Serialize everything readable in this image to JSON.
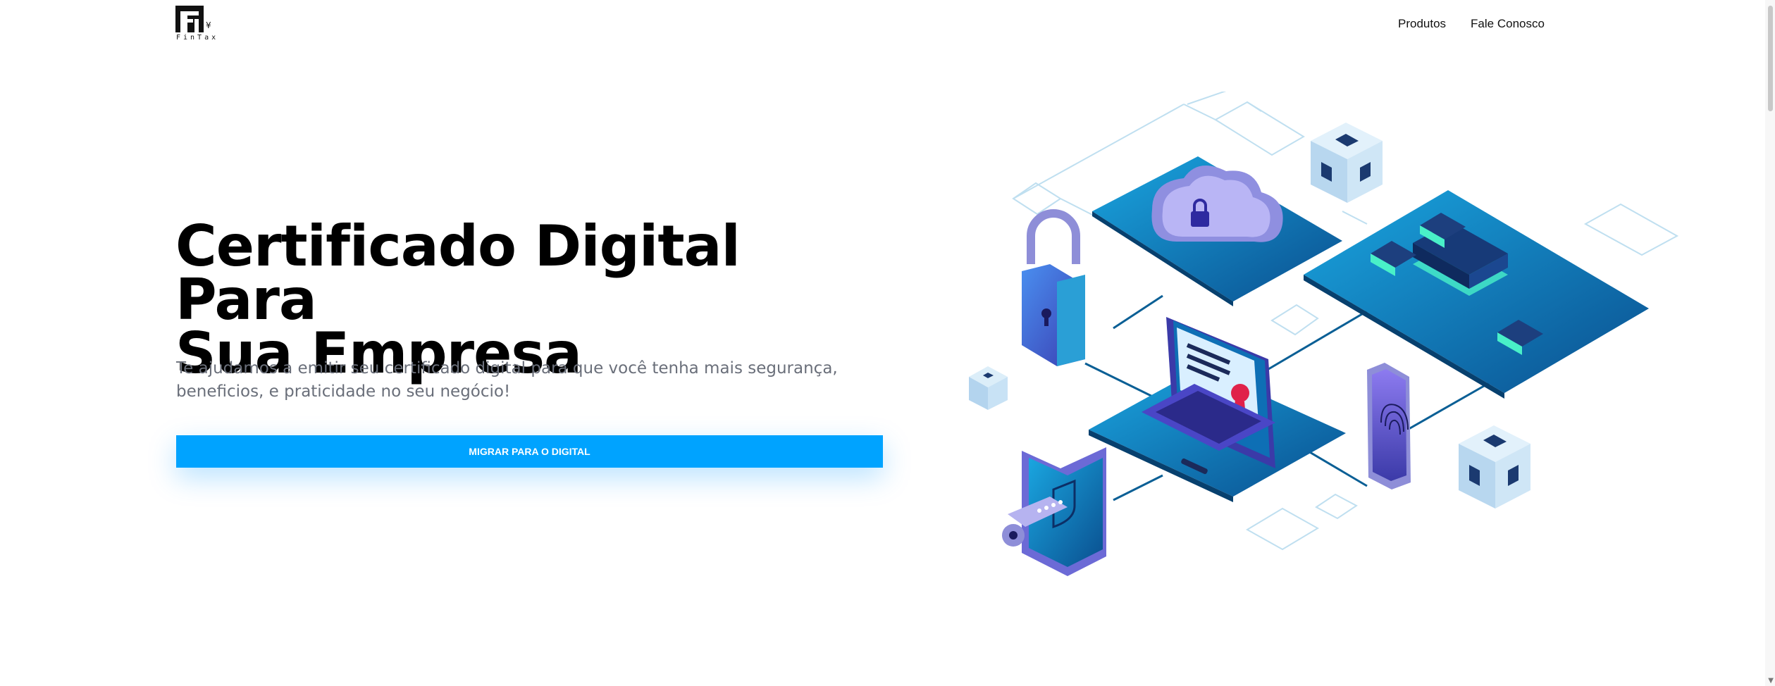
{
  "brand": {
    "logo_text": "FinTax"
  },
  "nav": {
    "items": [
      {
        "label": "Produtos"
      },
      {
        "label": "Fale Conosco"
      }
    ]
  },
  "hero": {
    "title_line1": "Certificado Digital Para",
    "title_line2": "Sua Empresa",
    "subtitle": "Te ajudamos a emitir seu certificado digital para que você tenha mais segurança, beneficios, e praticidade no seu negócio!",
    "cta_label": "MIGRAR PARA O DIGITAL"
  },
  "colors": {
    "accent": "#00a3ff",
    "platform": "#0a6fb0",
    "dark_blue": "#0b3a78",
    "teal": "#49f0c8",
    "purple": "#6b5ad8"
  }
}
